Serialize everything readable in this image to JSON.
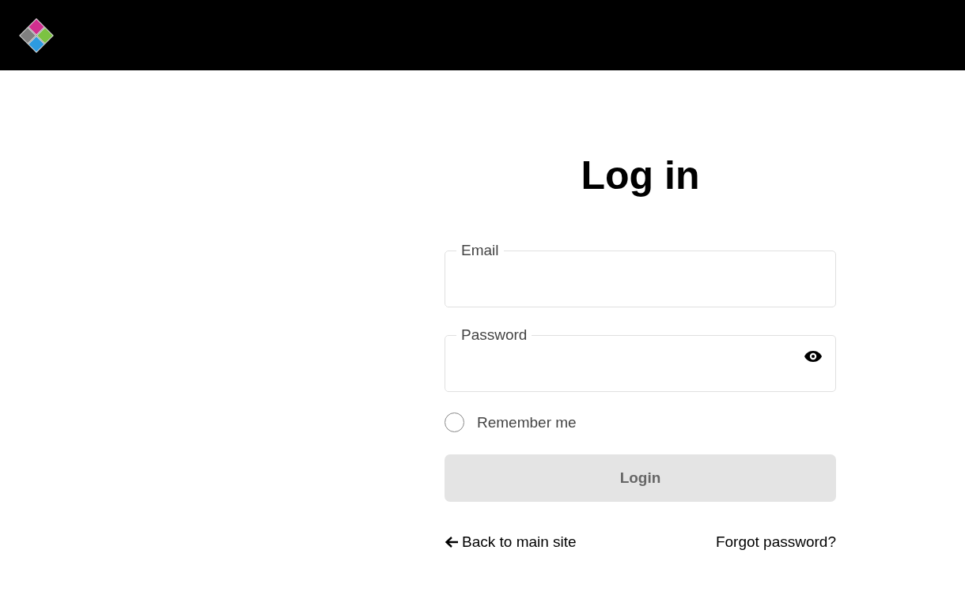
{
  "form": {
    "title": "Log in",
    "fields": [
      {
        "kind": "email",
        "label": "Email"
      },
      {
        "kind": "password",
        "label": "Password"
      }
    ],
    "remember": {
      "label": "Remember me",
      "checked": false
    },
    "submit": {
      "label": "Login",
      "disabled": true
    },
    "links": [
      {
        "kind": "back",
        "label": "Back to main site"
      },
      {
        "kind": "plain",
        "label": "Forgot password?"
      }
    ]
  }
}
